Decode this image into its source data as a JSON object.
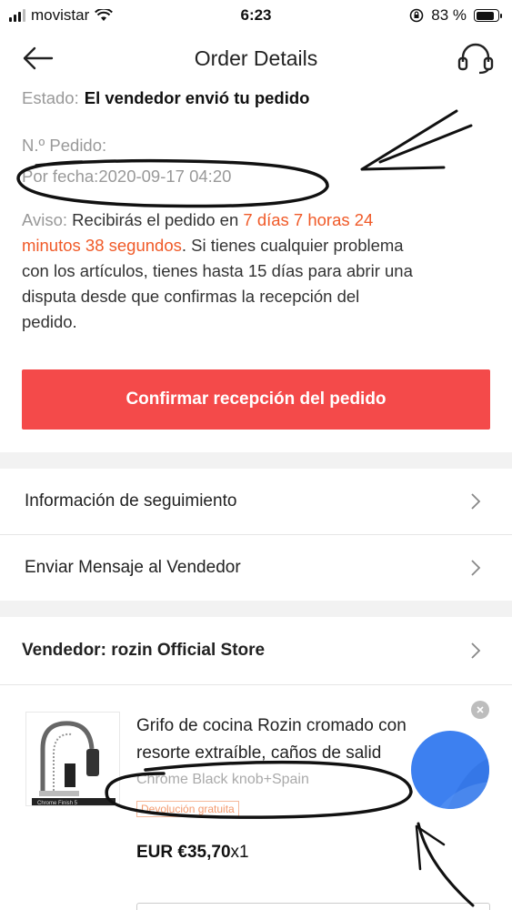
{
  "status_bar": {
    "carrier": "movistar",
    "time": "6:23",
    "battery": "83 %"
  },
  "header": {
    "title": "Order Details"
  },
  "order": {
    "status_label": "Estado:",
    "status_value": "El vendedor envió tu pedido",
    "order_no_label": "N.º Pedido:",
    "date_label": "Por fecha:",
    "date_value": "2020-09-17 04:20",
    "notice_label": "Aviso:",
    "notice_pre": " Recibirás el pedido en ",
    "notice_countdown_1": "7 días 7 horas 24",
    "notice_countdown_2": "minutos 38 segundos",
    "notice_line2_rest": ". Si tienes cualquier problema",
    "notice_line3": "con los artículos, tienes hasta 15 días para abrir una",
    "notice_line4": "disputa desde que confirmas la recepción del",
    "notice_line5": "pedido."
  },
  "actions": {
    "confirm_label": "Confirmar recepción del pedido"
  },
  "menu": {
    "tracking_label": "Información de seguimiento",
    "message_label": "Enviar Mensaje al Vendedor"
  },
  "seller": {
    "label": "Vendedor:",
    "name": "rozin Official Store"
  },
  "product": {
    "title_line1": "Grifo de cocina Rozin cromado con",
    "title_line2": "resorte extraíble, caños de salid",
    "variant": "Chrome Black knob+Spain",
    "badge": "Devolución gratuita",
    "price": "EUR €35,70",
    "qty": "x1",
    "image_caption": "Chrome Finish 5"
  },
  "colors": {
    "accent_red": "#f44a4a",
    "countdown_orange": "#f05a28",
    "fab_blue": "#3d80f0"
  }
}
